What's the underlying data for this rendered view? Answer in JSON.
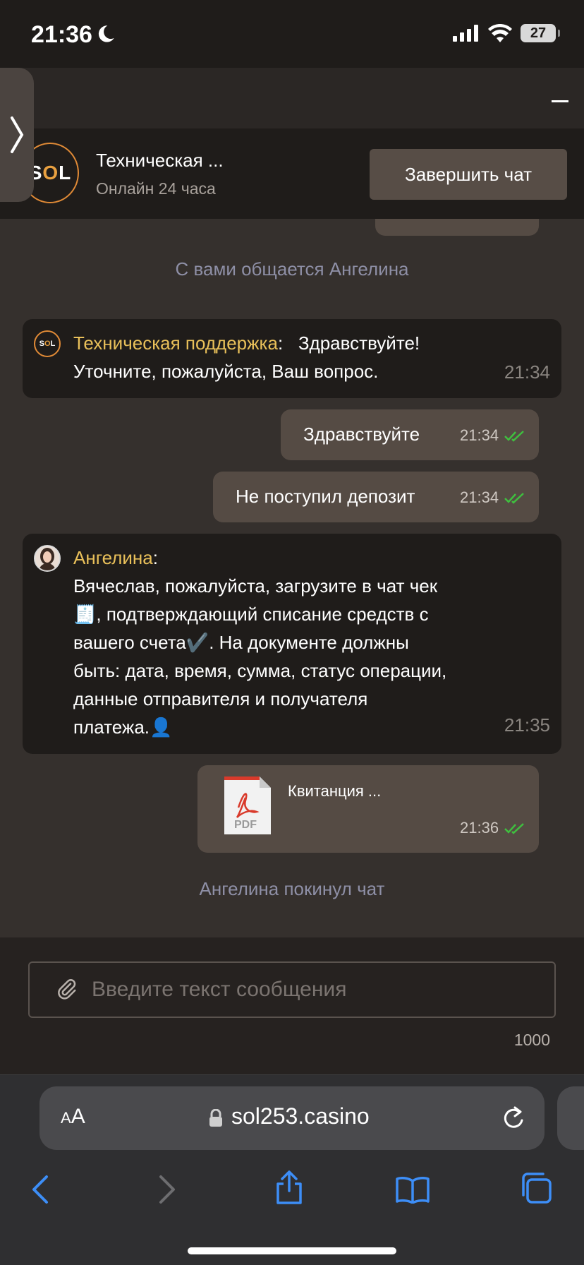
{
  "status_bar": {
    "time": "21:36",
    "battery": "27"
  },
  "header": {
    "logo_text_s": "S",
    "logo_text_o": "O",
    "logo_text_l": "L",
    "title": "Техническая ...",
    "subtitle": "Онлайн 24 часа",
    "end_chat_label": "Завершить чат"
  },
  "messages": {
    "system_joined": "С вами общается Ангелина",
    "support": {
      "sender": "Техническая поддержка",
      "text_line1": "Здравствуйте!",
      "text_line2": "Уточните, пожалуйста, Ваш вопрос.",
      "time": "21:34"
    },
    "out1": {
      "text": "Здравствуйте",
      "time": "21:34"
    },
    "out2": {
      "text": "Не поступил депозит",
      "time": "21:34"
    },
    "agent": {
      "sender": "Ангелина",
      "line1": "Вячеслав, пожалуйста, загрузите в чат чек",
      "line2": "🧾, подтверждающий списание средств с",
      "line3": "вашего счета✔️. На документе должны",
      "line4": "быть: дата, время, сумма, статус операции,",
      "line5": "данные отправителя и получателя",
      "line6": "платежа.👤",
      "time": "21:35"
    },
    "file": {
      "name": "Квитанция ...",
      "icon_label": "PDF",
      "time": "21:36"
    },
    "system_left": "Ангелина покинул чат"
  },
  "composer": {
    "placeholder": "Введите текст сообщения",
    "counter": "1000"
  },
  "browser": {
    "aa_small": "A",
    "aa_big": "A",
    "url": "sol253.casino"
  },
  "colors": {
    "accent": "#e9c05a",
    "brand_orange": "#e08a36",
    "check_green": "#3fbf3f",
    "ios_blue": "#3d8ef7"
  }
}
